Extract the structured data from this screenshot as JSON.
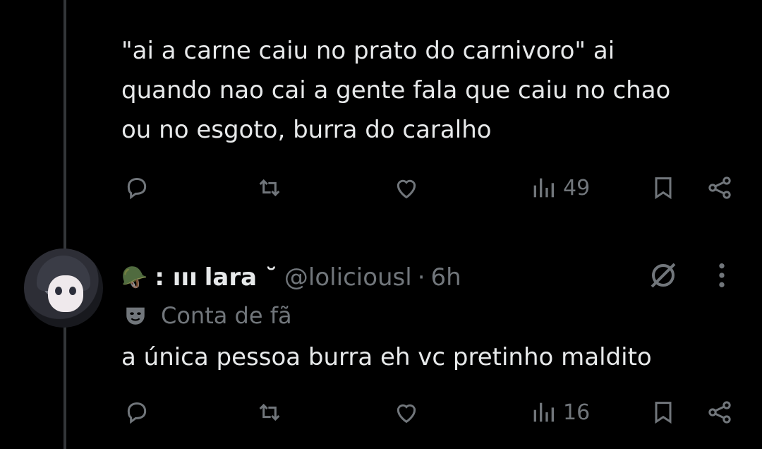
{
  "post1": {
    "text": "\"ai a carne caiu no prato do carnivoro\" ai\nquando nao cai a gente fala que caiu no chao\nou no esgoto, burra do caralho",
    "views": "49"
  },
  "post2": {
    "prefix": ": ııı",
    "display_name": "lara ˘",
    "handle": "@loliciousl",
    "separator": "·",
    "time": "6h",
    "badge": "Conta de fã",
    "text": "a única pessoa burra eh vc pretinho maldito",
    "views": "16"
  },
  "icons": {
    "reply": "reply-icon",
    "repost": "repost-icon",
    "like": "heart-icon",
    "views": "views-icon",
    "bookmark": "bookmark-icon",
    "share": "share-icon",
    "grok": "grok-icon",
    "more": "more-icon",
    "emoji": "helmet-emoji",
    "fan": "mask-icon"
  },
  "colors": {
    "background": "#000000",
    "text": "#e7e9ea",
    "muted": "#71767b",
    "line": "#333639"
  }
}
